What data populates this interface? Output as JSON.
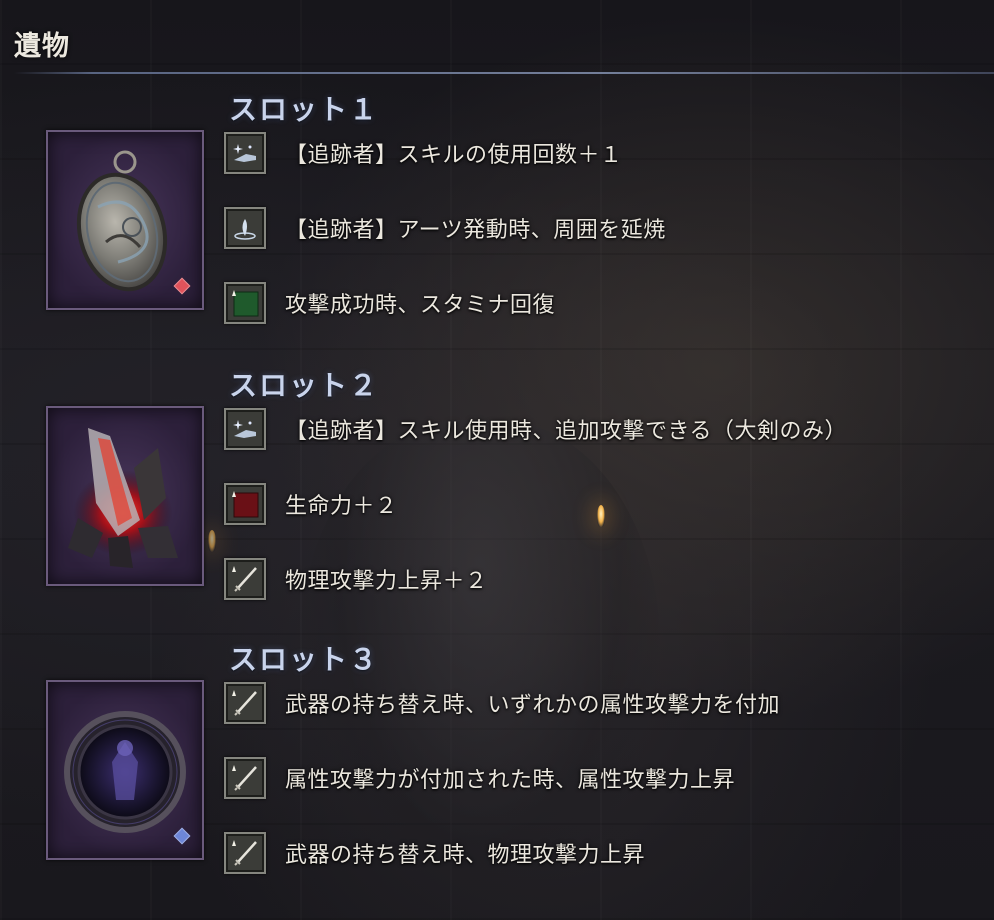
{
  "header": {
    "title": "遺物"
  },
  "slots": [
    {
      "title": "スロット１",
      "relic": {
        "icon": "pendant-icon",
        "gem_color": "#e0535b"
      },
      "effects": [
        {
          "icon": "hand-sparkle-icon",
          "text": "【追跡者】スキルの使用回数＋１"
        },
        {
          "icon": "skill-burst-icon",
          "text": "【追跡者】アーツ発動時、周囲を延焼"
        },
        {
          "icon": "stamina-up-icon",
          "text": "攻撃成功時、スタミナ回復"
        }
      ]
    },
    {
      "title": "スロット２",
      "relic": {
        "icon": "red-crystal-icon",
        "gem_color": ""
      },
      "effects": [
        {
          "icon": "hand-sparkle-icon",
          "text": "【追跡者】スキル使用時、追加攻撃できる（大剣のみ）"
        },
        {
          "icon": "vitality-up-icon",
          "text": "生命力＋２"
        },
        {
          "icon": "sword-up-icon",
          "text": "物理攻撃力上昇＋２"
        }
      ]
    },
    {
      "title": "スロット３",
      "relic": {
        "icon": "dark-medallion-icon",
        "gem_color": "#6d86d8"
      },
      "effects": [
        {
          "icon": "sword-up-icon",
          "text": "武器の持ち替え時、いずれかの属性攻撃力を付加"
        },
        {
          "icon": "sword-up-icon",
          "text": "属性攻撃力が付加された時、属性攻撃力上昇"
        },
        {
          "icon": "sword-up-icon",
          "text": "武器の持ち替え時、物理攻撃力上昇"
        }
      ]
    }
  ]
}
